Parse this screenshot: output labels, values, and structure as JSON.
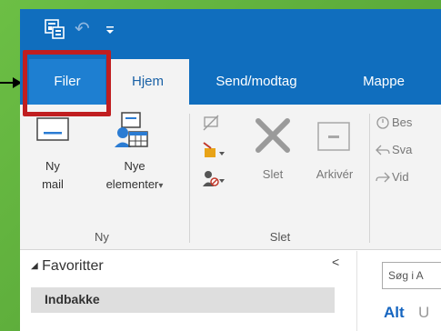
{
  "qat": {
    "app_icon": "send-receive-icon",
    "undo_icon": "undo-icon",
    "more_icon": "customize-qat-icon"
  },
  "tabs": [
    {
      "label": "Filer"
    },
    {
      "label": "Hjem"
    },
    {
      "label": "Send/modtag"
    },
    {
      "label": "Mappe"
    }
  ],
  "ribbon": {
    "new_group": {
      "label": "Ny",
      "new_mail": {
        "line1": "Ny",
        "line2": "mail",
        "icon": "mail-icon"
      },
      "new_items": {
        "line1": "Nye",
        "line2": "elementer",
        "icon": "new-items-icon",
        "arrow": "▾"
      }
    },
    "delete_group": {
      "label": "Slet",
      "delete": {
        "label": "Slet",
        "icon": "delete-x-icon"
      },
      "archive": {
        "label": "Arkivér",
        "icon": "archive-icon"
      },
      "small_icons": [
        "ignore-icon",
        "cleanup-icon",
        "junk-icon"
      ]
    },
    "respond_group": {
      "items": [
        {
          "label": "Bes",
          "icon": "meeting-icon"
        },
        {
          "label": "Sva",
          "icon": "reply-icon"
        },
        {
          "label": "Vid",
          "icon": "forward-icon"
        }
      ]
    }
  },
  "pane": {
    "favorites_label": "Favoritter",
    "favorites_arrow": "◢",
    "inbox_label": "Indbakke",
    "collapse_glyph": "<",
    "search_placeholder": "Søg i A",
    "filter_all": "Alt",
    "filter_next": "U"
  },
  "colors": {
    "titlebar": "#106ebe",
    "highlight": "#c01e20",
    "accent_text": "#1565c0"
  }
}
